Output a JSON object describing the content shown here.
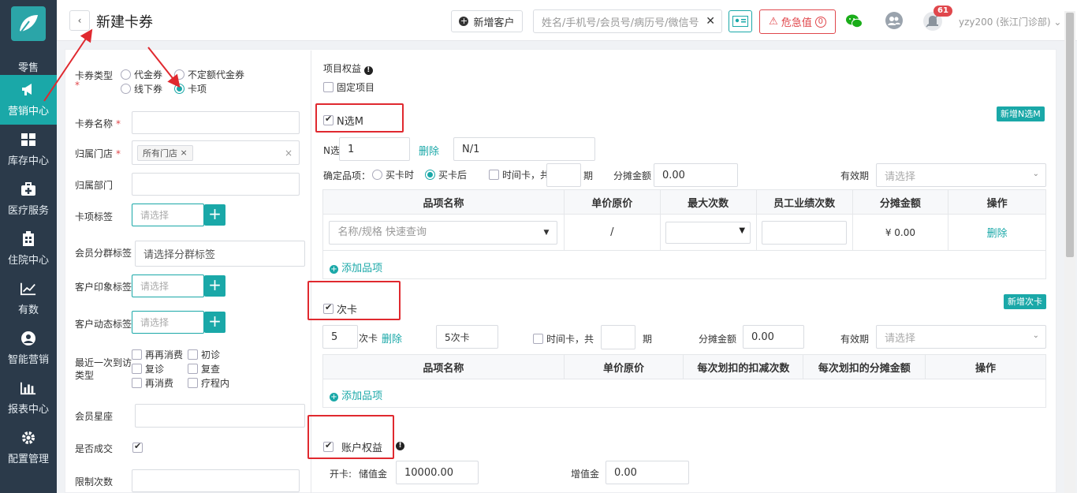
{
  "sidebar": {
    "items": [
      {
        "label": "零售"
      },
      {
        "label": "营销中心"
      },
      {
        "label": "库存中心"
      },
      {
        "label": "医疗服务"
      },
      {
        "label": "住院中心"
      },
      {
        "label": "有数"
      },
      {
        "label": "智能营销"
      },
      {
        "label": "报表中心"
      },
      {
        "label": "配置管理"
      }
    ]
  },
  "topbar": {
    "title": "新建卡券",
    "add_customer": "新增客户",
    "search_placeholder": "姓名/手机号/会员号/病历号/微信号",
    "danger_label": "危急值",
    "danger_count": "0",
    "bell_badge": "61",
    "user": "yzy200 (张江门诊部)"
  },
  "form": {
    "card_type_label": "卡券类型",
    "card_types": [
      "代金券",
      "不定额代金券",
      "线下券",
      "卡项"
    ],
    "card_name_label": "卡券名称",
    "store_label": "归属门店",
    "store_chip": "所有门店",
    "dept_label": "归属部门",
    "card_tag_label": "卡项标签",
    "card_tag_placeholder": "请选择",
    "member_group_label": "会员分群标签",
    "member_group_placeholder": "请选择分群标签",
    "impression_label": "客户印象标签",
    "impression_placeholder": "请选择",
    "dynamic_label": "客户动态标签",
    "dynamic_placeholder": "请选择",
    "visit_type_label": "最近一次到访类型",
    "visit_types": [
      "再再消费",
      "初诊",
      "复诊",
      "复查",
      "再消费",
      "疗程内"
    ],
    "constellation_label": "会员星座",
    "deal_label": "是否成交",
    "limit_label": "限制次数"
  },
  "right": {
    "project_rights": "项目权益",
    "fixed_project": "固定项目",
    "n_choose_m": "N选M",
    "add_n_choose_m": "新增N选M",
    "n_label": "N选",
    "n_value": "1",
    "delete": "删除",
    "n_over": "N/1",
    "confirm_label": "确定品项：",
    "buy_when": "买卡时",
    "buy_after": "买卡后",
    "time_card": "时间卡，共",
    "period": "期",
    "split_amount": "分摊金额",
    "split_value": "0.00",
    "valid_label": "有效期",
    "valid_placeholder": "请选择",
    "table1": {
      "headers": [
        "品项名称",
        "单价原价",
        "最大次数",
        "员工业绩次数",
        "分摊金额",
        "操作"
      ],
      "row": {
        "name_placeholder": "名称/规格 快速查询",
        "price": "/",
        "amount": "¥ 0.00",
        "op": "删除"
      }
    },
    "add_item": "添加品项",
    "count_card": "次卡",
    "add_count_card": "新增次卡",
    "count_value": "5",
    "count_unit": "次卡",
    "count_name": "5次卡",
    "split_value2": "0.00",
    "table2": {
      "headers": [
        "品项名称",
        "单价原价",
        "每次划扣的扣减次数",
        "每次划扣的分摊金额",
        "操作"
      ]
    },
    "account_rights": "账户权益",
    "open_card": "开卡:",
    "stored_value": "储值金",
    "stored_amount": "10000.00",
    "bonus_value": "增值金",
    "bonus_amount": "0.00"
  }
}
